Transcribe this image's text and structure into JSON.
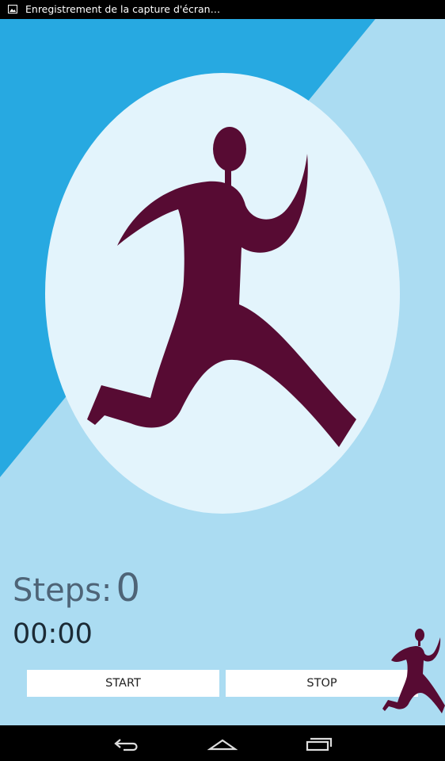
{
  "status_bar": {
    "notification_icon": "screenshot-image-icon",
    "notification_text": "Enregistrement de la capture d'écran…"
  },
  "colors": {
    "background_dark": "#27a9e1",
    "background_light": "#abdcf2",
    "ellipse": "#e3f4fc",
    "runner": "#570b33",
    "steps_text": "#4e6477",
    "timer_text": "#1c2b36"
  },
  "counter": {
    "label": "Steps:",
    "value": "0"
  },
  "timer": {
    "value": "00:00"
  },
  "buttons": {
    "start": "START",
    "stop": "STOP"
  },
  "nav_bar": {
    "back_icon": "back-icon",
    "home_icon": "home-icon",
    "recent_icon": "recent-apps-icon"
  }
}
